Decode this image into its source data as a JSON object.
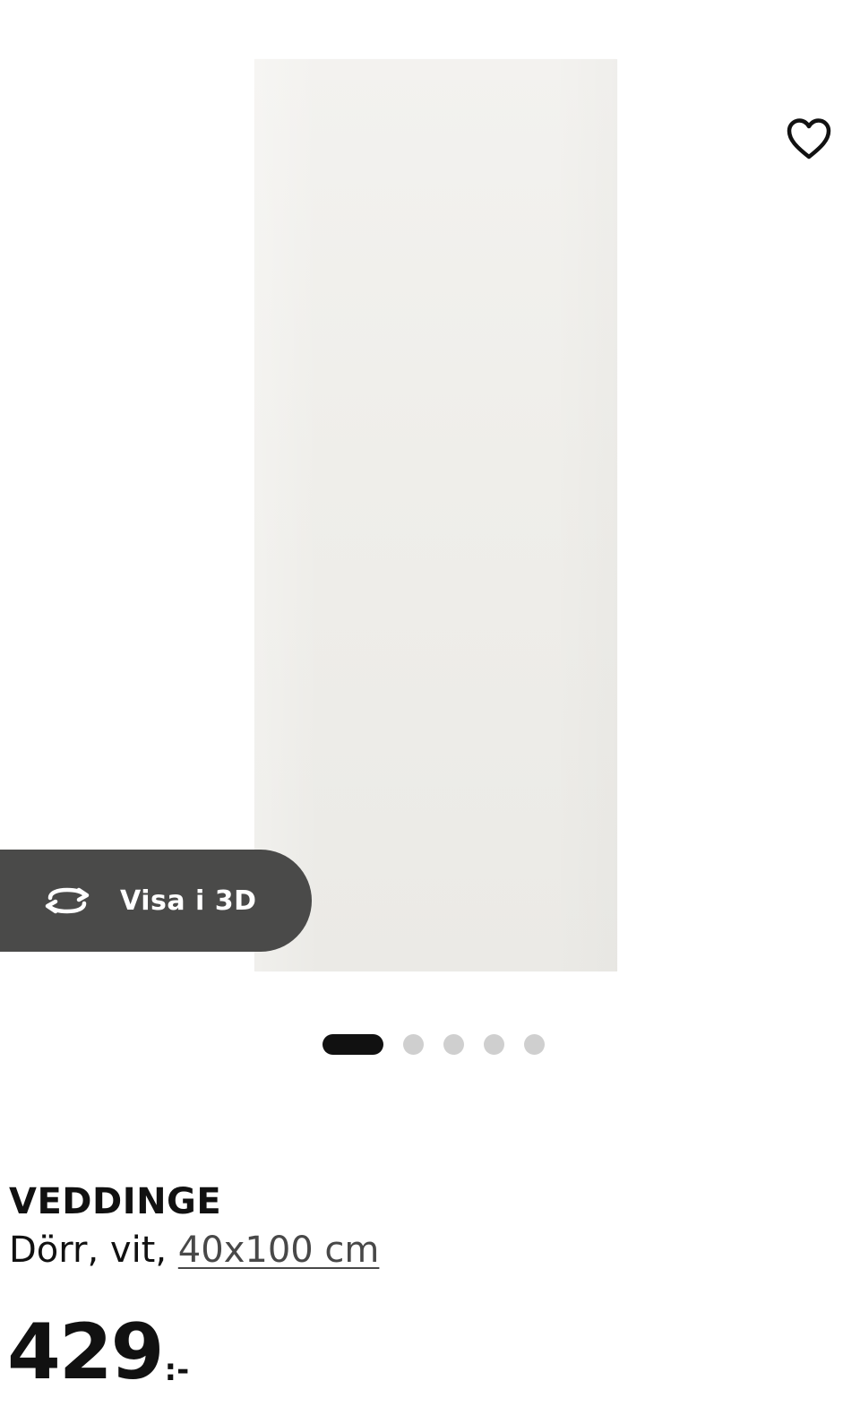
{
  "product": {
    "name": "VEDDINGE",
    "description_prefix": "Dörr, vit, ",
    "size": "40x100 cm",
    "price_amount": "429",
    "price_suffix": ":-"
  },
  "gallery": {
    "view3d_label": "Visa i 3D",
    "total_images": 5,
    "active_index": 0
  },
  "icons": {
    "favorite": "heart-icon",
    "view3d": "rotate-3d-icon"
  },
  "colors": {
    "view3d_background": "#4a4a49",
    "active_dot": "#111111",
    "inactive_dot": "#cfcfcf"
  }
}
